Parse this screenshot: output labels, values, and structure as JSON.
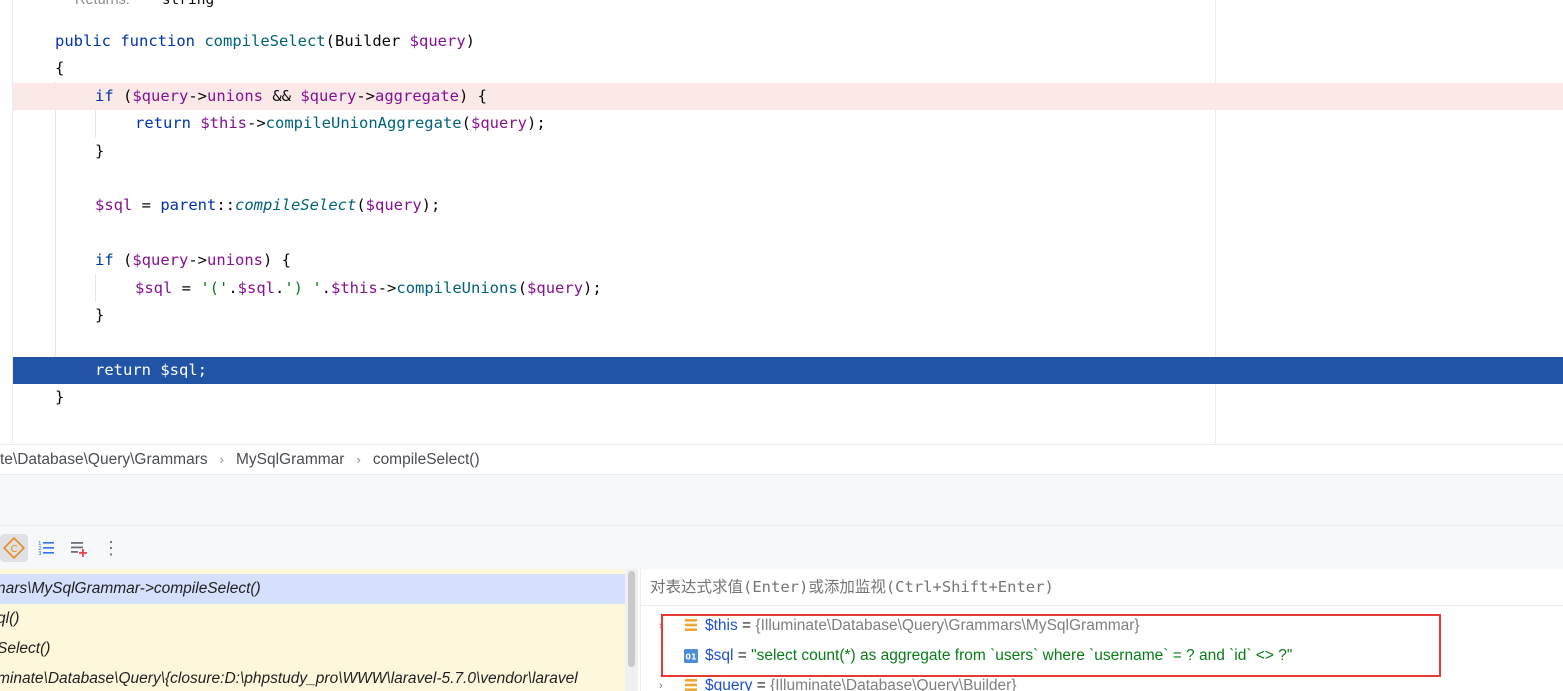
{
  "editor": {
    "doc_hint": {
      "label": "Returns:",
      "type": "string"
    },
    "lines": [
      {
        "tokens": [
          {
            "t": "public ",
            "c": "kw"
          },
          {
            "t": "function ",
            "c": "kw"
          },
          {
            "t": "compileSelect",
            "c": "fn"
          },
          {
            "t": "(Builder ",
            "c": ""
          },
          {
            "t": "$query",
            "c": "var"
          },
          {
            "t": ")",
            "c": ""
          }
        ]
      },
      {
        "tokens": [
          {
            "t": "{",
            "c": ""
          }
        ]
      },
      {
        "tokens": [
          {
            "t": "if ",
            "c": "kw"
          },
          {
            "t": "(",
            "c": ""
          },
          {
            "t": "$query",
            "c": "var"
          },
          {
            "t": "->",
            "c": ""
          },
          {
            "t": "unions",
            "c": "prop"
          },
          {
            "t": " && ",
            "c": ""
          },
          {
            "t": "$query",
            "c": "var"
          },
          {
            "t": "->",
            "c": ""
          },
          {
            "t": "aggregate",
            "c": "prop"
          },
          {
            "t": ") {",
            "c": ""
          }
        ]
      },
      {
        "tokens": [
          {
            "t": "return ",
            "c": "kw"
          },
          {
            "t": "$this",
            "c": "var"
          },
          {
            "t": "->",
            "c": ""
          },
          {
            "t": "compileUnionAggregate",
            "c": "fn"
          },
          {
            "t": "(",
            "c": ""
          },
          {
            "t": "$query",
            "c": "var"
          },
          {
            "t": ");",
            "c": ""
          }
        ]
      },
      {
        "tokens": [
          {
            "t": "}",
            "c": ""
          }
        ]
      },
      {
        "tokens": []
      },
      {
        "tokens": [
          {
            "t": "$sql",
            "c": "var"
          },
          {
            "t": " = ",
            "c": ""
          },
          {
            "t": "parent",
            "c": "kw"
          },
          {
            "t": "::",
            "c": ""
          },
          {
            "t": "compileSelect",
            "c": "italic-fn"
          },
          {
            "t": "(",
            "c": ""
          },
          {
            "t": "$query",
            "c": "var"
          },
          {
            "t": ");",
            "c": ""
          }
        ]
      },
      {
        "tokens": []
      },
      {
        "tokens": [
          {
            "t": "if ",
            "c": "kw"
          },
          {
            "t": "(",
            "c": ""
          },
          {
            "t": "$query",
            "c": "var"
          },
          {
            "t": "->",
            "c": ""
          },
          {
            "t": "unions",
            "c": "prop"
          },
          {
            "t": ") {",
            "c": ""
          }
        ]
      },
      {
        "tokens": [
          {
            "t": "$sql",
            "c": "var"
          },
          {
            "t": " = ",
            "c": ""
          },
          {
            "t": "'('",
            "c": "str"
          },
          {
            "t": ".",
            "c": ""
          },
          {
            "t": "$sql",
            "c": "var"
          },
          {
            "t": ".",
            "c": ""
          },
          {
            "t": "') '",
            "c": "str"
          },
          {
            "t": ".",
            "c": ""
          },
          {
            "t": "$this",
            "c": "var"
          },
          {
            "t": "->",
            "c": ""
          },
          {
            "t": "compileUnions",
            "c": "fn"
          },
          {
            "t": "(",
            "c": ""
          },
          {
            "t": "$query",
            "c": "var"
          },
          {
            "t": ");",
            "c": ""
          }
        ]
      },
      {
        "tokens": [
          {
            "t": "}",
            "c": ""
          }
        ]
      },
      {
        "tokens": []
      },
      {
        "tokens": [
          {
            "t": "return ",
            "c": "kw"
          },
          {
            "t": "$sql",
            "c": "var"
          },
          {
            "t": ";",
            "c": ""
          }
        ]
      },
      {
        "tokens": [
          {
            "t": "}",
            "c": ""
          }
        ]
      }
    ]
  },
  "breadcrumb": [
    "te\\Database\\Query\\Grammars",
    "MySqlGrammar",
    "compileSelect()"
  ],
  "breadcrumb_sep": "›",
  "toolbar": {
    "more_glyph": "⋮"
  },
  "frames": [
    "nars\\MySqlGrammar->compileSelect()",
    "ql()",
    "Select()",
    "minate\\Database\\Query\\{closure:D:\\phpstudy_pro\\WWW\\laravel-5.7.0\\vendor\\laravel"
  ],
  "variables": {
    "eval_placeholder": "对表达式求值(Enter)或添加监视(Ctrl+Shift+Enter)",
    "rows": [
      {
        "name": "$this",
        "eq": " = ",
        "value": "{Illuminate\\Database\\Query\\Grammars\\MySqlGrammar}",
        "kind": "object"
      },
      {
        "name": "$sql",
        "eq": " = ",
        "value": "\"select count(*) as aggregate from `users` where `username` = ? and `id` <> ?\"",
        "kind": "string"
      },
      {
        "name": "$query",
        "eq": " = ",
        "value": "{Illuminate\\Database\\Query\\Builder}",
        "kind": "object"
      }
    ],
    "string_icon_text": "01"
  },
  "colors": {
    "exec_line": "#2154a5",
    "error_line": "#fae9e7",
    "highlight_box": "#e53935"
  }
}
